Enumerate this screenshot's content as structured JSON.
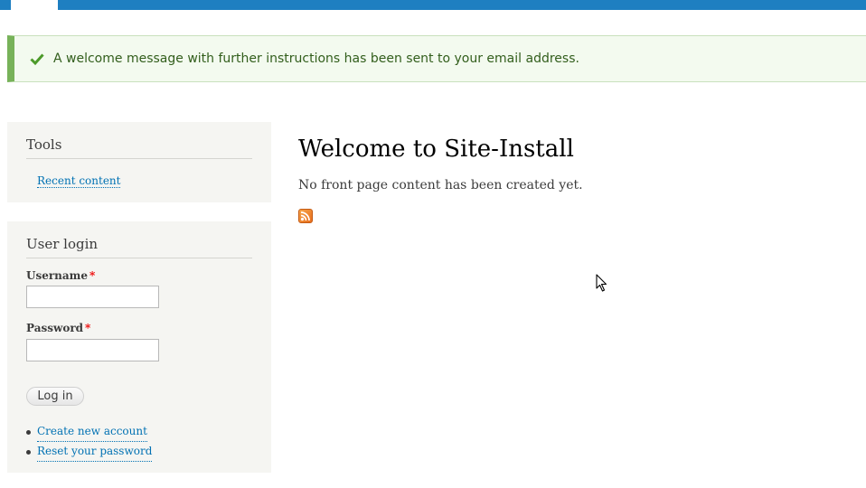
{
  "colors": {
    "topbar": "#1e7fc1",
    "status_bg": "#f3faef",
    "status_accent": "#77b259",
    "link": "#0071b3",
    "block_bg": "#f5f5f2",
    "required": "#ee0000"
  },
  "status_message": {
    "icon": "check-icon",
    "text": "A welcome message with further instructions has been sent to your email address."
  },
  "tools_block": {
    "title": "Tools",
    "links": [
      "Recent content"
    ]
  },
  "login_block": {
    "title": "User login",
    "username_label": "Username",
    "username_value": "",
    "password_label": "Password",
    "password_value": "",
    "required_marker": "*",
    "submit_label": "Log in",
    "links": [
      "Create new account",
      "Reset your password"
    ]
  },
  "main": {
    "title": "Welcome to Site-Install",
    "body": "No front page content has been created yet.",
    "feed_icon": "rss-feed-icon"
  }
}
